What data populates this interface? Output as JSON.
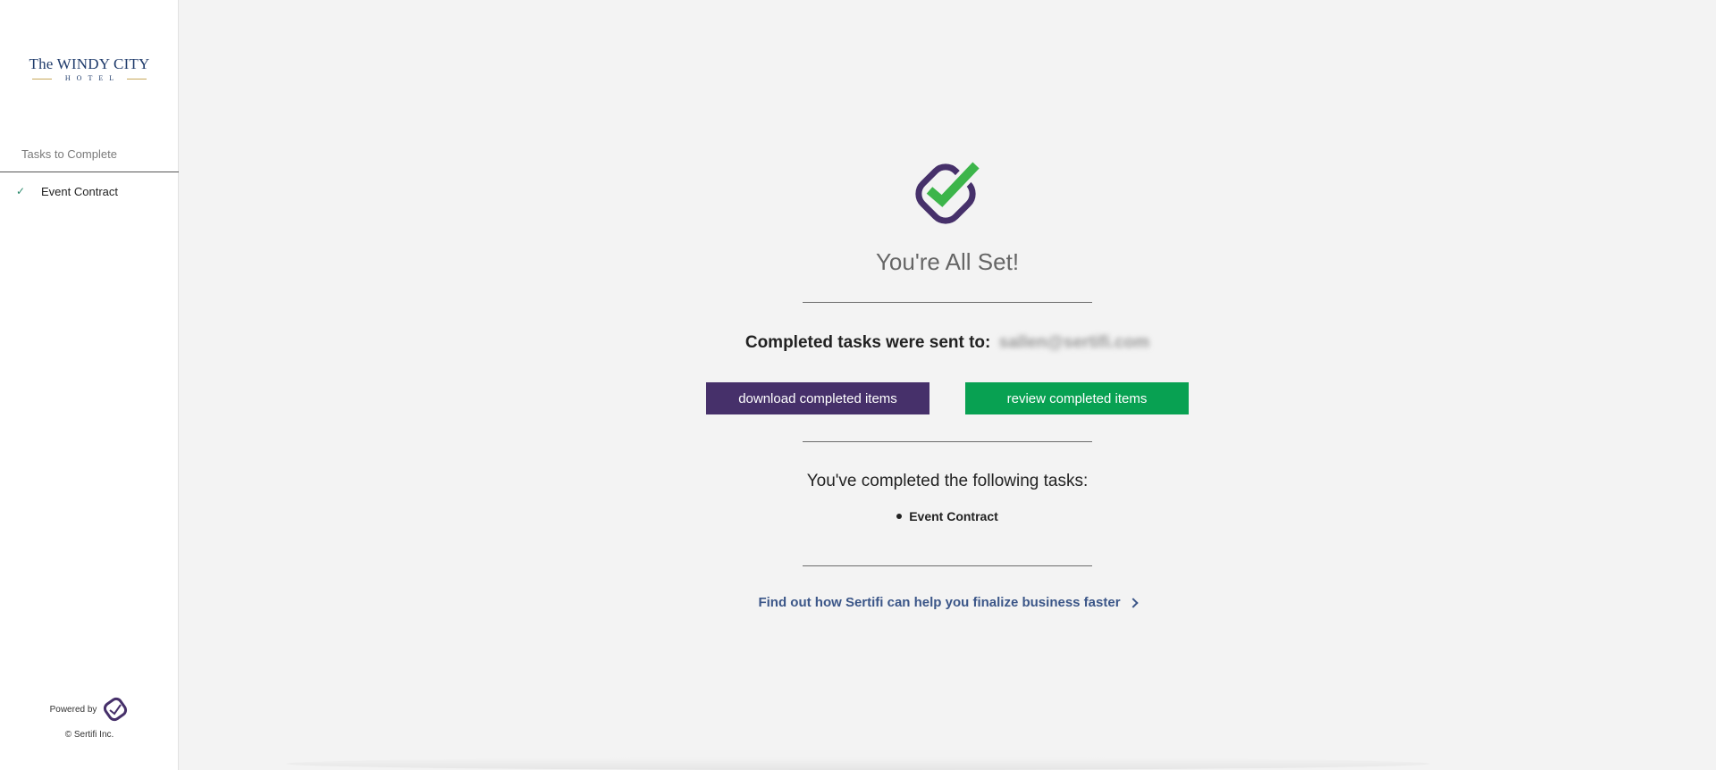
{
  "sidebar": {
    "logo": {
      "main": "The WINDY CITY",
      "sub": "HOTEL"
    },
    "tasks_heading": "Tasks to Complete",
    "tasks": [
      {
        "label": "Event Contract",
        "status_icon": "check-icon"
      }
    ],
    "powered_by": "Powered by",
    "copyright": "© Sertifi Inc."
  },
  "main": {
    "title": "You're All Set!",
    "sent_to_label": "Completed tasks were sent to:",
    "sent_to_email": "sallen@sertifi.com",
    "buttons": {
      "download": "download completed items",
      "review": "review completed items"
    },
    "completed_heading": "You've completed the following tasks:",
    "completed_tasks": [
      "Event Contract"
    ],
    "promo_link": "Find out how Sertifi can help you finalize business faster"
  },
  "colors": {
    "purple": "#46306a",
    "green": "#08a152",
    "link": "#3b5688",
    "logo": "#1f3b6b"
  }
}
